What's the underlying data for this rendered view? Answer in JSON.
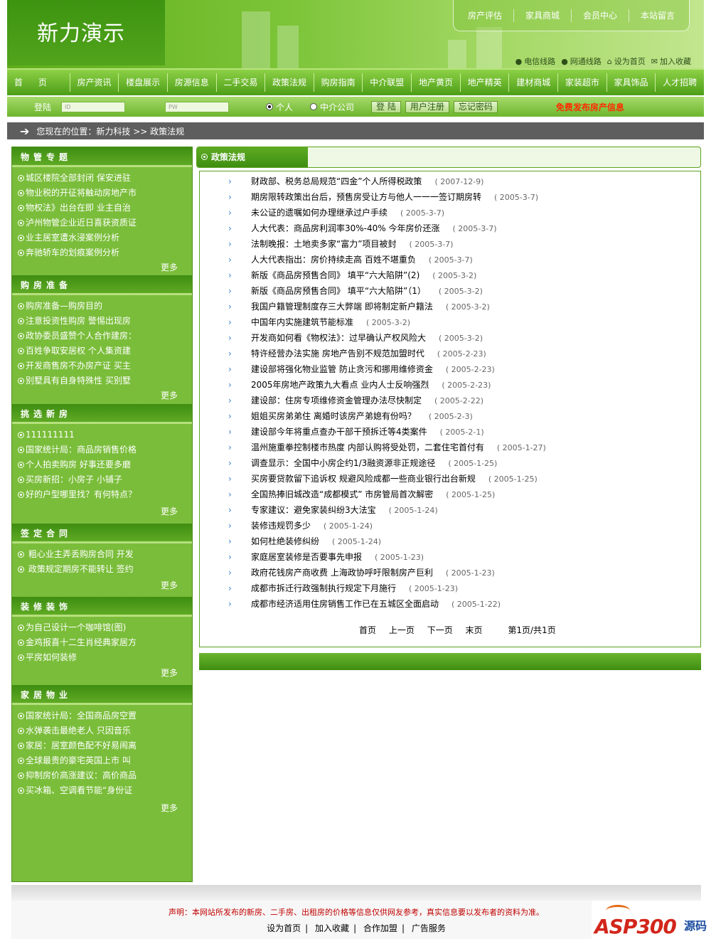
{
  "header": {
    "site_title": "新力演示",
    "top_links": [
      "房产评估",
      "家具商城",
      "会员中心",
      "本站留言"
    ],
    "quick_links": [
      "电信线路",
      "网通线路",
      "设为首页",
      "加入收藏"
    ]
  },
  "main_nav": [
    "首页",
    "房产资讯",
    "楼盘展示",
    "房源信息",
    "二手交易",
    "政策法规",
    "购房指南",
    "中介联盟",
    "地产黄页",
    "地产精英",
    "建材商城",
    "家装超市",
    "家具饰品",
    "人才招聘"
  ],
  "login": {
    "label": "登陆",
    "user_placeholder": "ID",
    "pass_placeholder": "PW",
    "radio_person": "个人",
    "radio_agent": "中介公司",
    "btn_login": "登 陆",
    "btn_register": "用户注册",
    "btn_forgot": "忘记密码",
    "free_post": "免费发布房产信息"
  },
  "location": {
    "text": "您现在的位置：新力科技 >> 政策法规"
  },
  "sidebar": [
    {
      "title": "物管专题",
      "items": [
        "城区楼院全部封闭 保安进驻",
        "物业税的开征将触动房地产市",
        "物权法》出台在即  业主自治",
        "泸州物管企业近日喜获资质证",
        "业主居室遭水浸案例分析",
        "奔驰轿车的划痕案例分析"
      ],
      "more": "更多"
    },
    {
      "title": "购房准备",
      "items": [
        "购房准备—购房目的",
        "注意投资性购房  警惕出现房",
        "政协委员盛赞个人合作建房：",
        "百姓争取安居权  个人集资建",
        "开发商售房不办房产证  买主",
        "别墅具有自身特殊性  买别墅"
      ],
      "more": "更多"
    },
    {
      "title": "挑选新房",
      "items": [
        "111111111",
        "国家统计局：商品房销售价格",
        "个人拍卖购房  好事还要多磨",
        "买房新招：小房子 小铺子",
        "好的户型哪里找？有何特点？"
      ],
      "more": "更多"
    },
    {
      "title": "签定合同",
      "items": [
        " 粗心业主弄丢购房合同 开发",
        " 政策规定期房不能转让  签约"
      ],
      "more": "更多"
    },
    {
      "title": "装修装饰",
      "items": [
        "为自己设计一个咖啡馆(图)",
        "金鸡报喜十二生肖经典家居方",
        "平房如何装修"
      ],
      "more": "更多"
    },
    {
      "title": "家居物业",
      "items": [
        "国家统计局：全国商品房空置",
        "水弹袭击最绝老人  只因音乐",
        "家居：居室颜色配不好易闹离",
        "全球最贵的豪宅英国上市  叫",
        "抑制房价高涨建议：高价商品",
        "买冰箱、空调看节能“身份证"
      ],
      "more": "更多"
    }
  ],
  "content": {
    "tab_title": "政策法规",
    "bullet": "›",
    "articles": [
      {
        "title": "财政部、税务总局规范“四金”个人所得税政策",
        "date": "( 2007-12-9)"
      },
      {
        "title": "期房限转政策出台后，预售房受让方与他人一一一签订期房转",
        "date": "( 2005-3-7)"
      },
      {
        "title": "未公证的遗嘱如何办理继承过户手续",
        "date": "( 2005-3-7)"
      },
      {
        "title": "人大代表：商品房利润率30%-40% 今年房价还涨",
        "date": "( 2005-3-7)"
      },
      {
        "title": "法制晚报：土地卖多家“富力”项目被封",
        "date": "( 2005-3-7)"
      },
      {
        "title": "人大代表指出：房价持续走高 百姓不堪重负",
        "date": "( 2005-3-7)"
      },
      {
        "title": "新版《商品房预售合同》 填平“六大陷阱”(2)",
        "date": "( 2005-3-2)"
      },
      {
        "title": "新版《商品房预售合同》 填平“六大陷阱”（1）",
        "date": "( 2005-3-2)"
      },
      {
        "title": "我国户籍管理制度存三大弊端 即将制定新户籍法",
        "date": "( 2005-3-2)"
      },
      {
        "title": "中国年内实施建筑节能标准",
        "date": "( 2005-3-2)"
      },
      {
        "title": "开发商如何看《物权法》：过早确认产权风险大",
        "date": "( 2005-3-2)"
      },
      {
        "title": "特许经营办法实施 房地产告别不规范加盟时代",
        "date": "( 2005-2-23)"
      },
      {
        "title": "建设部将强化物业监管 防止贪污和挪用维修资金",
        "date": "( 2005-2-23)"
      },
      {
        "title": "2005年房地产政策九大看点 业内人士反响强烈",
        "date": "( 2005-2-23)"
      },
      {
        "title": "建设部：住房专项维修资金管理办法尽快制定",
        "date": "( 2005-2-22)"
      },
      {
        "title": "姐姐买房弟弟住 离婚时该房产弟媳有份吗？",
        "date": "( 2005-2-3)"
      },
      {
        "title": "建设部今年将重点查办干部干预拆迁等4类案件",
        "date": "( 2005-2-1)"
      },
      {
        "title": "温州施重拳控制楼市热度 内部认购将受处罚，二套住宅首付有",
        "date": "( 2005-1-27)"
      },
      {
        "title": "调查显示：全国中小房企约1/3融资源非正规途径",
        "date": "( 2005-1-25)"
      },
      {
        "title": "买房要贷款留下追诉权 规避风险成都一些商业银行出台新规",
        "date": "( 2005-1-25)"
      },
      {
        "title": "全国热捧旧城改造“成都模式” 市房管局首次解密",
        "date": "( 2005-1-25)"
      },
      {
        "title": "专家建议：避免家装纠纷3大法宝",
        "date": "( 2005-1-24)"
      },
      {
        "title": "装修违规罚多少",
        "date": "( 2005-1-24)"
      },
      {
        "title": "如何杜绝装修纠纷",
        "date": "( 2005-1-24)"
      },
      {
        "title": "家庭居室装修是否要事先申报",
        "date": "( 2005-1-23)"
      },
      {
        "title": "政府花钱房产商收费 上海政协呼吁限制房产巨利",
        "date": "( 2005-1-23)"
      },
      {
        "title": "成都市拆迁行政强制执行规定下月施行",
        "date": "( 2005-1-23)"
      },
      {
        "title": "成都市经济适用住房销售工作已在五城区全面启动",
        "date": "( 2005-1-22)"
      }
    ],
    "pager": {
      "first": "首页",
      "prev": "上一页",
      "next": "下一页",
      "last": "末页",
      "info": "第1页/共1页"
    }
  },
  "footer": {
    "notice": "声明：本网站所发布的新房、二手房、出租房的价格等信息仅供网友参考，真实信息要以发布者的资料为准。",
    "links": [
      "设为首页",
      "加入收藏",
      "合作加盟",
      "广告服务"
    ],
    "separator": "|"
  },
  "watermark": {
    "text": "ASP300",
    "cn": "源码"
  },
  "colors": {
    "primary_green": "#5faa24",
    "dark_green": "#3e8d12",
    "notice_red": "#c00000",
    "free_post_red": "#ff2b00"
  }
}
